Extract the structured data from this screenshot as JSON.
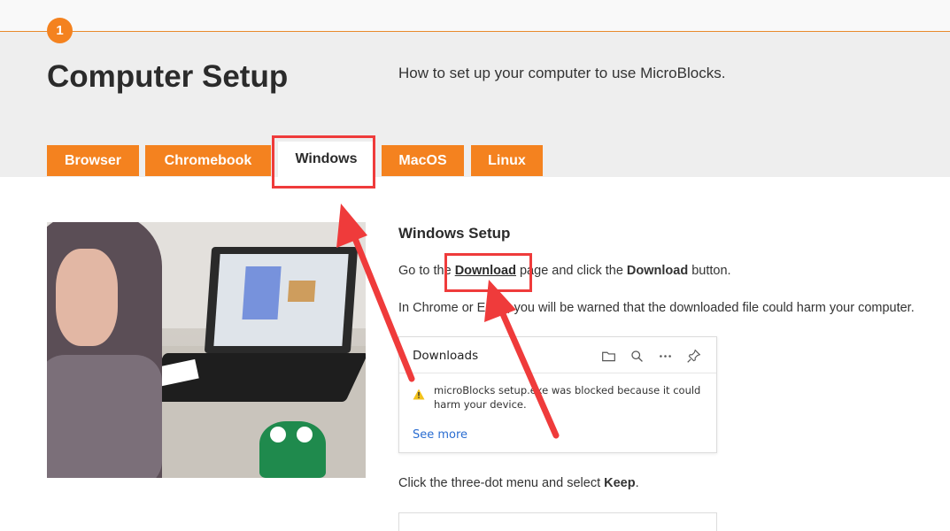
{
  "step": {
    "number": "1"
  },
  "header": {
    "title": "Computer Setup",
    "subtitle": "How to set up your computer to use MicroBlocks."
  },
  "tabs": [
    {
      "label": "Browser",
      "active": false
    },
    {
      "label": "Chromebook",
      "active": false
    },
    {
      "label": "Windows",
      "active": true
    },
    {
      "label": "MacOS",
      "active": false
    },
    {
      "label": "Linux",
      "active": false
    }
  ],
  "content": {
    "heading": "Windows Setup",
    "para1": {
      "before": "Go to the ",
      "link": "Download",
      "middle": " page and click the ",
      "bold": "Download",
      "after": " button."
    },
    "para2": "In Chrome or Edge, you will be warned that the downloaded file could harm your computer.",
    "para3": {
      "before": "Click the three-dot menu and select ",
      "bold": "Keep",
      "after": "."
    }
  },
  "downloads_panel": {
    "title": "Downloads",
    "message": "microBlocks setup.exe was blocked because it could harm your device.",
    "see_more": "See more",
    "icons": [
      "folder-icon",
      "search-icon",
      "more-icon",
      "pin-icon",
      "warning-icon"
    ]
  },
  "colors": {
    "accent": "#f4821f",
    "highlight": "#ef3b3b",
    "link_blue": "#2a6dd1"
  }
}
